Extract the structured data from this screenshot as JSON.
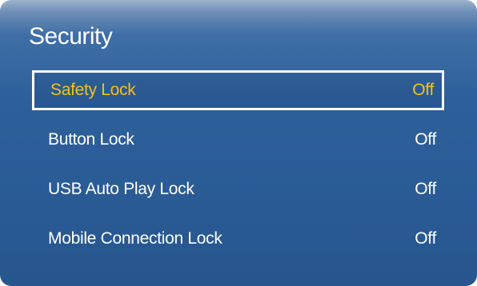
{
  "panel": {
    "title": "Security",
    "accent_color": "#f6c018",
    "background_color": "#2d5f9a"
  },
  "menu": {
    "items": [
      {
        "label": "Safety Lock",
        "value": "Off",
        "selected": true
      },
      {
        "label": "Button Lock",
        "value": "Off",
        "selected": false
      },
      {
        "label": "USB Auto Play Lock",
        "value": "Off",
        "selected": false
      },
      {
        "label": "Mobile Connection Lock",
        "value": "Off",
        "selected": false
      }
    ]
  }
}
